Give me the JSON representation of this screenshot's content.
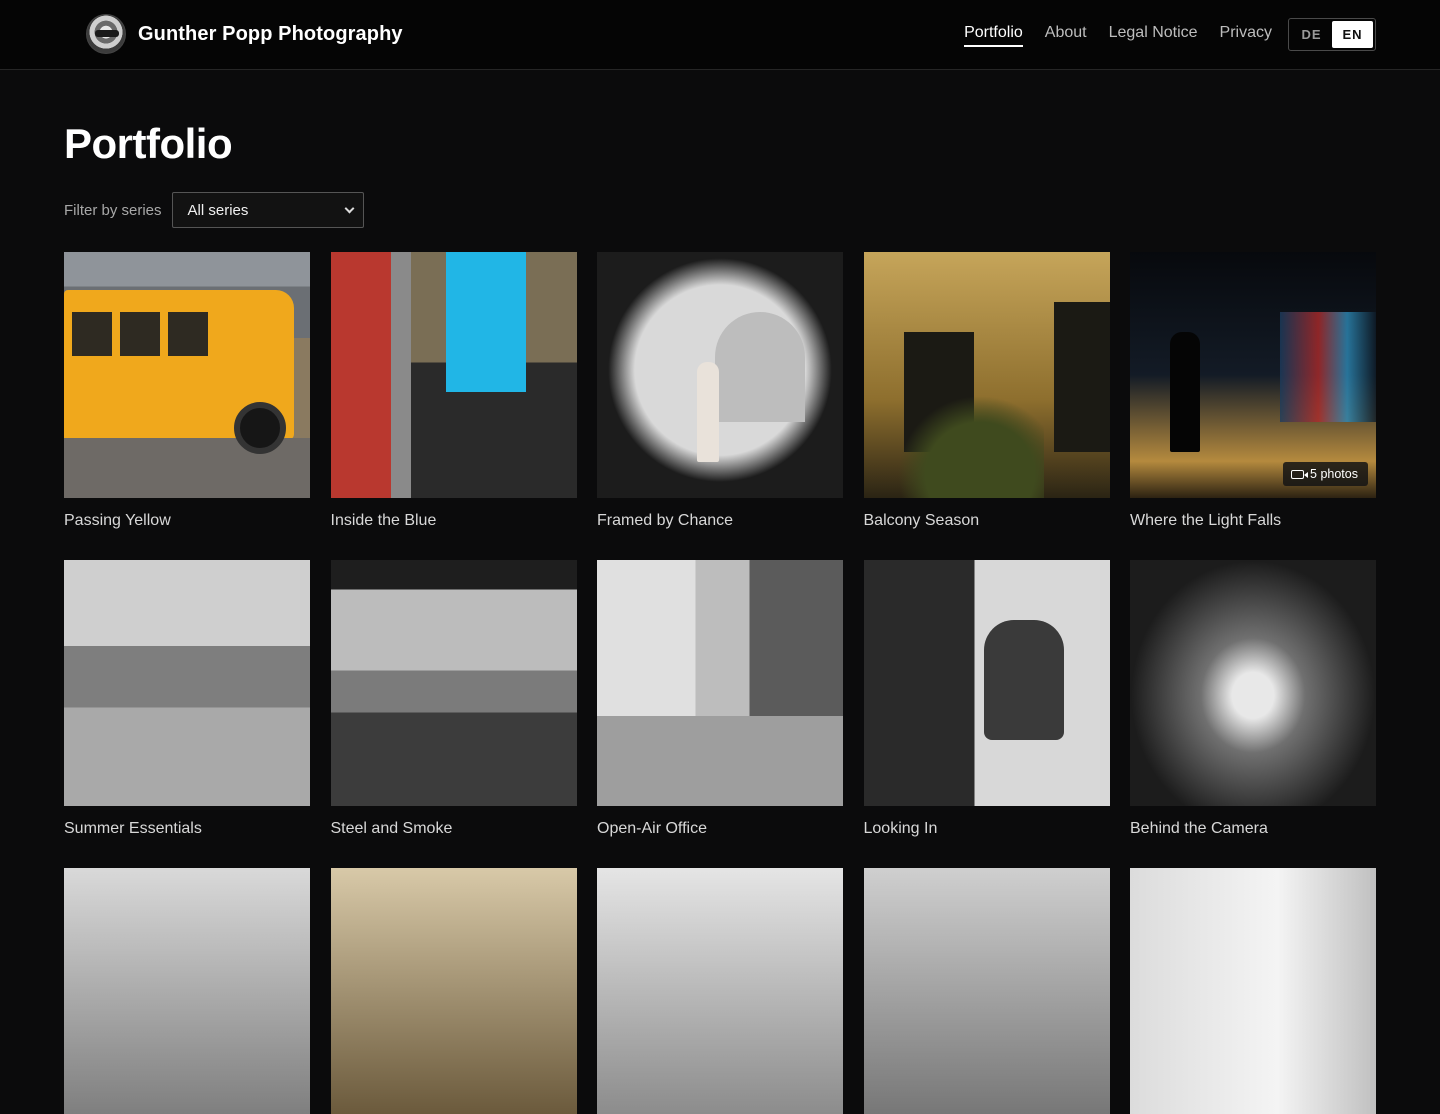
{
  "header": {
    "brand": "Gunther Popp Photography",
    "nav": [
      {
        "label": "Portfolio",
        "active": true
      },
      {
        "label": "About",
        "active": false
      },
      {
        "label": "Legal Notice",
        "active": false
      },
      {
        "label": "Privacy",
        "active": false
      }
    ],
    "languages": [
      {
        "code": "DE",
        "active": false
      },
      {
        "code": "EN",
        "active": true
      }
    ]
  },
  "main": {
    "title": "Portfolio",
    "filter": {
      "label": "Filter by series",
      "selected": "All series"
    },
    "photos": [
      {
        "title": "Passing Yellow"
      },
      {
        "title": "Inside the Blue"
      },
      {
        "title": "Framed by Chance"
      },
      {
        "title": "Balcony Season"
      },
      {
        "title": "Where the Light Falls",
        "badge": "5 photos"
      },
      {
        "title": "Summer Essentials"
      },
      {
        "title": "Steel and Smoke"
      },
      {
        "title": "Open-Air Office"
      },
      {
        "title": "Looking In"
      },
      {
        "title": "Behind the Camera"
      }
    ]
  },
  "colors": {
    "background": "#0b0b0c",
    "header": "#050505",
    "accent": "#ffffff"
  }
}
